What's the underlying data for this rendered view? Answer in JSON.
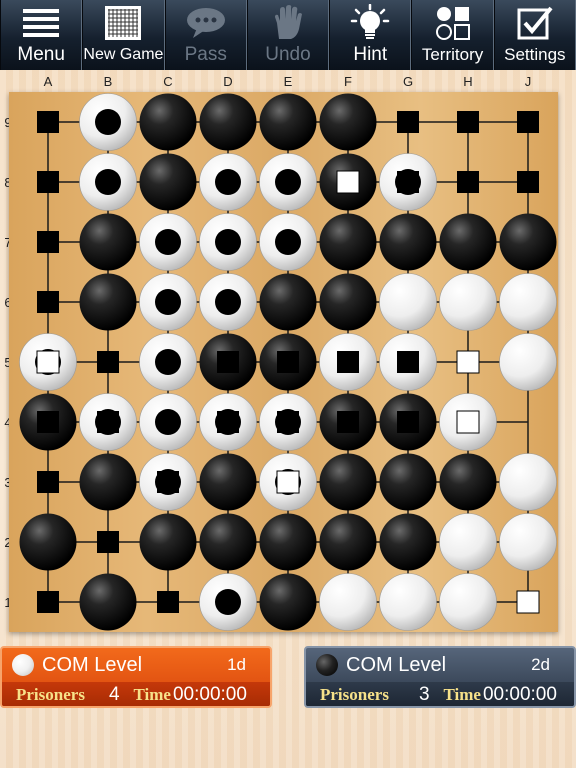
{
  "toolbar": {
    "items": [
      {
        "label": "Menu",
        "icon": "menu-icon",
        "enabled": true
      },
      {
        "label": "New Game",
        "icon": "grid-icon",
        "enabled": true
      },
      {
        "label": "Pass",
        "icon": "speech-bubble-icon",
        "enabled": false
      },
      {
        "label": "Undo",
        "icon": "hand-icon",
        "enabled": false
      },
      {
        "label": "Hint",
        "icon": "lightbulb-icon",
        "enabled": true
      },
      {
        "label": "Territory",
        "icon": "territory-icon",
        "enabled": true
      },
      {
        "label": "Settings",
        "icon": "checkbox-icon",
        "enabled": true
      }
    ]
  },
  "board": {
    "size": 9,
    "columns": [
      "A",
      "B",
      "C",
      "D",
      "E",
      "F",
      "G",
      "H",
      "J"
    ],
    "rows": [
      "9",
      "8",
      "7",
      "6",
      "5",
      "4",
      "3",
      "2",
      "1"
    ],
    "stones": [
      "-WBBBB---",
      "-WBWWBW--",
      "-BWWWBBBB",
      "-BWWBBWWW",
      "W-WBBWW-W",
      "BWWWWBBW-",
      "-BWBWBBBW",
      "B-BBBBBWW",
      "-B-WBWWW-"
    ],
    "marks": [
      "b-----bbb",
      "b----wbbb",
      "b--------",
      "b--------",
      "wb-bbbbw-",
      "bb-bbbbw-",
      "b-b-w----",
      "-b-------",
      "b-b-----w"
    ],
    "colors": {
      "wood": "#e0b06c",
      "line": "#1a1a1a",
      "black": "#111111",
      "white": "#f5f5f5"
    }
  },
  "players": {
    "white": {
      "name": "COM Level",
      "level": "1d",
      "prisoners_label": "Prisoners",
      "prisoners": "4",
      "time_label": "Time",
      "time": "00:00:00",
      "color": "#e34f12"
    },
    "black": {
      "name": "COM Level",
      "level": "2d",
      "prisoners_label": "Prisoners",
      "prisoners": "3",
      "time_label": "Time",
      "time": "00:00:00",
      "color": "#3b4757"
    }
  }
}
